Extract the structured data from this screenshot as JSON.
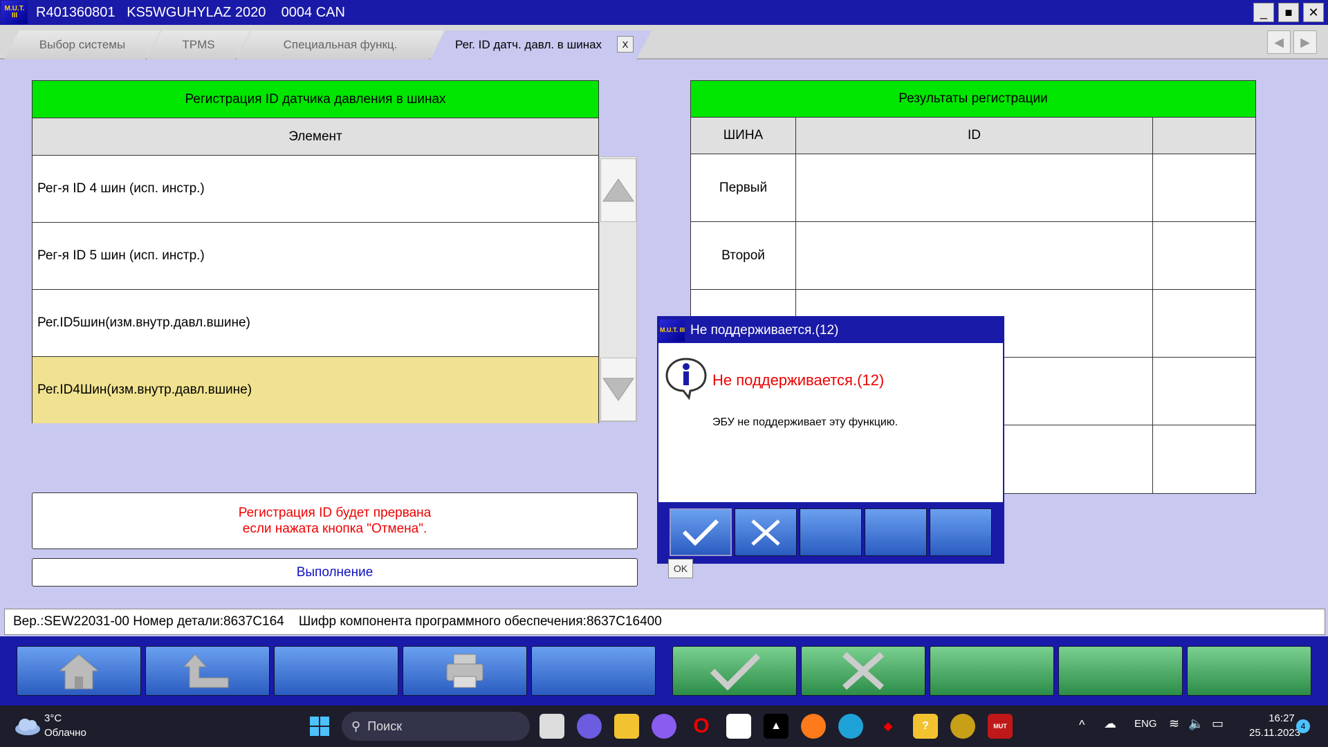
{
  "app": {
    "logo_text": "M.U.T. III",
    "title": "R401360801   KS5WGUHYLAZ 2020    0004 CAN",
    "minimize": "_",
    "maximize": "■",
    "close": "✕"
  },
  "tabs": [
    {
      "label": "Выбор системы"
    },
    {
      "label": "TPMS"
    },
    {
      "label": "Специальная функц."
    },
    {
      "label": "Рег. ID датч. давл. в шинах",
      "close": "X"
    }
  ],
  "left_table": {
    "title": "Регистрация ID датчика давления в шинах",
    "header": "Элемент",
    "rows": [
      "Рег-я ID 4 шин (исп. инстр.)",
      "Рег-я ID 5 шин (исп. инстр.)",
      "Рег.ID5шин(изм.внутр.давл.вшине)",
      "Рег.ID4Шин(изм.внутр.давл.вшине)"
    ],
    "selected_index": 3
  },
  "message": {
    "line1": "Регистрация ID будет прервана",
    "line2": "если нажата кнопка \"Отмена\"."
  },
  "execute_label": "Выполнение",
  "right_table": {
    "title": "Результаты регистрации",
    "col_tire": "ШИНА",
    "col_id": "ID",
    "rows": [
      "Первый",
      "Второй",
      "",
      "",
      ""
    ]
  },
  "dialog": {
    "logo_text": "M.U.T. III",
    "title": "Не поддерживается.(12)",
    "heading": "Не поддерживается.(12)",
    "body": "ЭБУ не поддерживает эту функцию.",
    "ok_label": "OK"
  },
  "status": "Вер.:SEW22031-00 Номер детали:8637C164    Шифр компонента программного обеспечения:8637C16400",
  "taskbar": {
    "weather_temp": "3°C",
    "weather_desc": "Облачно",
    "search_placeholder": "Поиск",
    "lang": "ENG",
    "time": "16:27",
    "date": "25.11.2023",
    "notif": "4"
  },
  "colors": {
    "accent_blue": "#1a1aa8",
    "header_green": "#00e600",
    "selected_row": "#f0e290",
    "alert_red": "#e00000"
  }
}
